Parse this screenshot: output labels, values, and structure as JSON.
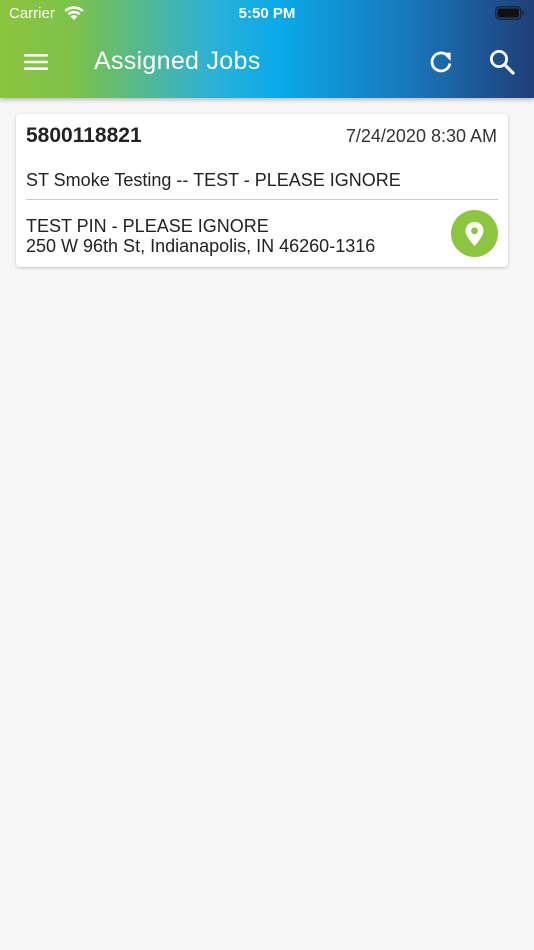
{
  "status_bar": {
    "carrier": "Carrier",
    "time": "5:50 PM"
  },
  "header": {
    "title": "Assigned Jobs",
    "menu_icon": "hamburger-menu-icon",
    "refresh_icon": "refresh-icon",
    "search_icon": "search-icon"
  },
  "jobs": [
    {
      "number": "5800118821",
      "datetime": "7/24/2020 8:30 AM",
      "description": "ST Smoke Testing -- TEST - PLEASE IGNORE",
      "site_name": "TEST PIN - PLEASE IGNORE",
      "address": "250 W 96th St, Indianapolis, IN  46260-1316",
      "map_icon": "map-pin-icon"
    }
  ],
  "colors": {
    "gradient_start": "#8bc53f",
    "gradient_mid": "#0aaae8",
    "gradient_end": "#1f3f78",
    "pin_button": "#8cc63f",
    "background": "#f7f7f7"
  }
}
